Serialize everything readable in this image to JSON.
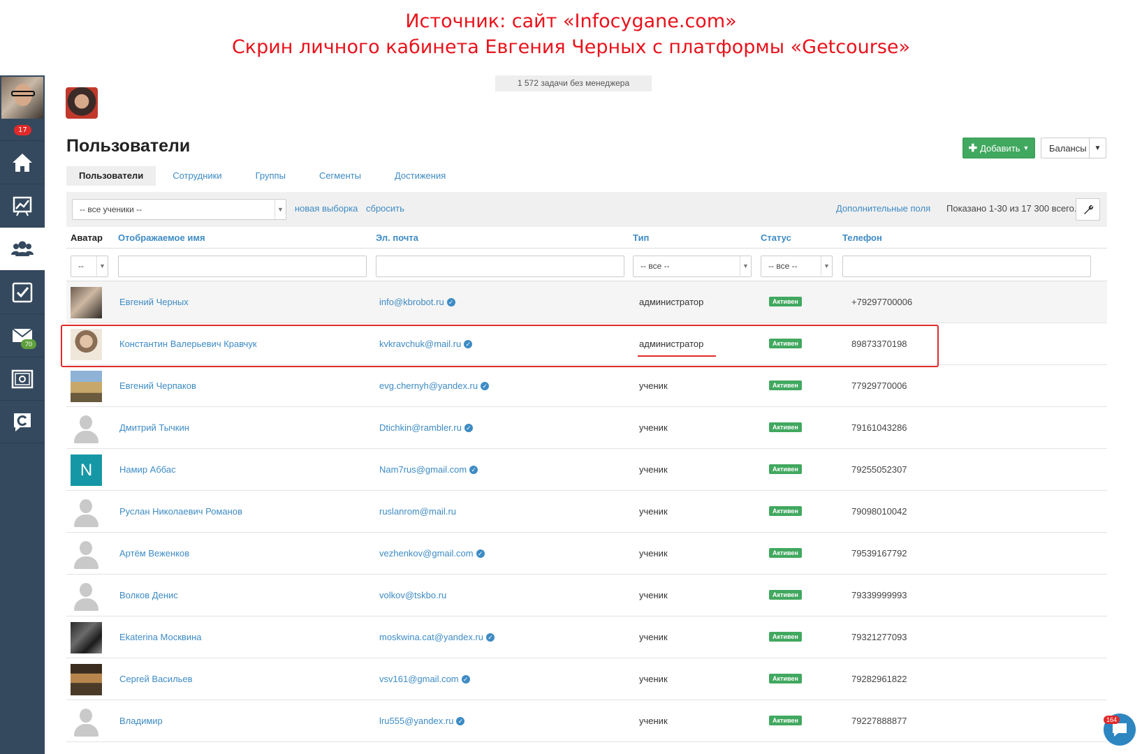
{
  "caption": {
    "line1": "Источник: сайт «Infocygane.com»",
    "line2": "Скрин личного кабинета Евгения Черных с платформы «Getcourse»"
  },
  "sidebar": {
    "notification_count": "17",
    "items": [
      {
        "icon": "home-icon"
      },
      {
        "icon": "chart-icon"
      },
      {
        "icon": "users-icon",
        "active": true
      },
      {
        "icon": "tasks-icon"
      },
      {
        "icon": "mail-icon",
        "badge": "70"
      },
      {
        "icon": "safe-icon"
      },
      {
        "icon": "getcourse-icon"
      }
    ]
  },
  "banner": "1 572 задачи без менеджера",
  "page": {
    "title": "Пользователи",
    "add_button": "Добавить",
    "balances_button": "Балансы"
  },
  "tabs": [
    "Пользователи",
    "Сотрудники",
    "Группы",
    "Сегменты",
    "Достижения"
  ],
  "filter": {
    "segment": "-- все ученики --",
    "new_selection": "новая выборка",
    "reset": "сбросить",
    "extra_fields": "Дополнительные поля",
    "shown": "Показано 1-30 из 17 300 всего."
  },
  "table": {
    "headers": {
      "avatar": "Аватар",
      "name": "Отображаемое имя",
      "email": "Эл. почта",
      "type": "Тип",
      "status": "Статус",
      "phone": "Телефон"
    },
    "filters": {
      "avatar": "--",
      "type": "-- все --",
      "status": "-- все --"
    },
    "rows": [
      {
        "name": "Евгений Черных",
        "email": "info@kbrobot.ru",
        "verified": true,
        "type": "администратор",
        "status": "Активен",
        "phone": "+79297700006"
      },
      {
        "name": "Константин Валерьевич Кравчук",
        "email": "kvkravchuk@mail.ru",
        "verified": true,
        "type": "администратор",
        "status": "Активен",
        "phone": "89873370198"
      },
      {
        "name": "Евгений Черпаков",
        "email": "evg.chernyh@yandex.ru",
        "verified": true,
        "type": "ученик",
        "status": "Активен",
        "phone": "77929770006"
      },
      {
        "name": "Дмитрий Тычкин",
        "email": "Dtichkin@rambler.ru",
        "verified": true,
        "type": "ученик",
        "status": "Активен",
        "phone": "79161043286"
      },
      {
        "name": "Намир Аббас",
        "email": "Nam7rus@gmail.com",
        "verified": true,
        "type": "ученик",
        "status": "Активен",
        "phone": "79255052307",
        "initial": "N"
      },
      {
        "name": "Руслан Николаевич Романов",
        "email": "ruslanrom@mail.ru",
        "verified": false,
        "type": "ученик",
        "status": "Активен",
        "phone": "79098010042"
      },
      {
        "name": "Артём Веженков",
        "email": "vezhenkov@gmail.com",
        "verified": true,
        "type": "ученик",
        "status": "Активен",
        "phone": "79539167792"
      },
      {
        "name": "Волков Денис",
        "email": "volkov@tskbo.ru",
        "verified": false,
        "type": "ученик",
        "status": "Активен",
        "phone": "79339999993"
      },
      {
        "name": "Ekaterina Москвина",
        "email": "moskwina.cat@yandex.ru",
        "verified": true,
        "type": "ученик",
        "status": "Активен",
        "phone": "79321277093"
      },
      {
        "name": "Сергей Васильев",
        "email": "vsv161@gmail.com",
        "verified": true,
        "type": "ученик",
        "status": "Активен",
        "phone": "79282961822"
      },
      {
        "name": "Владимир",
        "email": "lru555@yandex.ru",
        "verified": true,
        "type": "ученик",
        "status": "Активен",
        "phone": "79227888877"
      }
    ]
  },
  "chat": {
    "badge": "164"
  }
}
